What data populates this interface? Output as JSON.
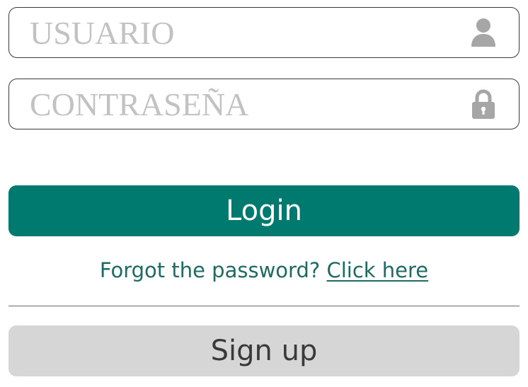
{
  "username_field": {
    "placeholder": "USUARIO",
    "value": "",
    "icon": "user-icon"
  },
  "password_field": {
    "placeholder": "CONTRASEÑA",
    "value": "",
    "icon": "lock-icon"
  },
  "login_button": {
    "label": "Login"
  },
  "forgot": {
    "text": "Forgot the password?",
    "link_label": "Click here"
  },
  "signup_button": {
    "label": "Sign up"
  },
  "colors": {
    "primary": "#007a6e",
    "link": "#1d6b63",
    "placeholder": "#c2c2c2",
    "icon": "#a6a6a6",
    "secondary_button": "#d6d6d6",
    "field_border": "#3a3a3a"
  }
}
